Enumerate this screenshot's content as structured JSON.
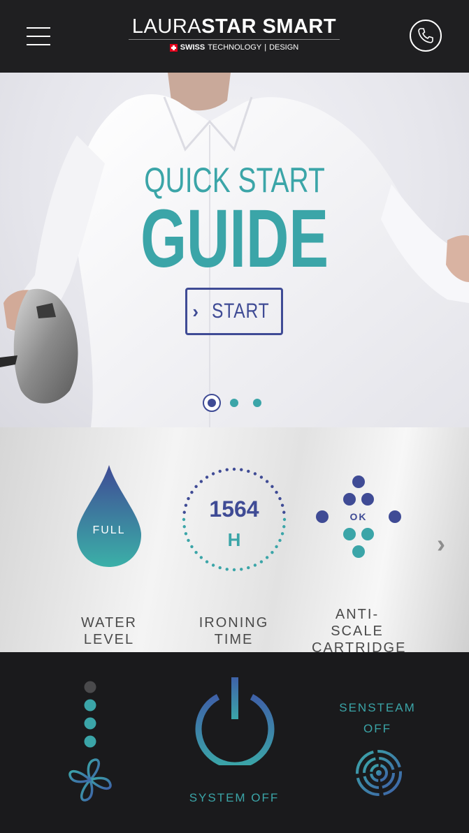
{
  "header": {
    "logo_light": "LAURA",
    "logo_bold": "STAR SMART",
    "tagline_bold": "SWISS",
    "tagline_rest": "TECHNOLOGY",
    "tagline_sep": "|",
    "tagline_end": "DESIGN"
  },
  "hero": {
    "title_line1": "QUICK START",
    "title_line2": "GUIDE",
    "start_chevron": "›",
    "start_label": "START",
    "carousel": {
      "pages": 3,
      "active": 1
    }
  },
  "status": {
    "water": {
      "value": "FULL",
      "label": "WATER LEVEL"
    },
    "ironing": {
      "value": "1564",
      "unit": "H",
      "label": "IRONING TIME"
    },
    "cartridge": {
      "value": "OK",
      "label_line1": "ANTI-SCALE",
      "label_line2": "CARTRIDGE"
    },
    "next_arrow": "›"
  },
  "controls": {
    "fan": {
      "levels": 4,
      "active_levels": 3
    },
    "power_label": "SYSTEM OFF",
    "sensteam_line1": "SENSTEAM",
    "sensteam_line2": "OFF"
  },
  "colors": {
    "accent_teal": "#3ba5a8",
    "accent_navy": "#3f4b95",
    "header_bg": "#1f1f21"
  }
}
